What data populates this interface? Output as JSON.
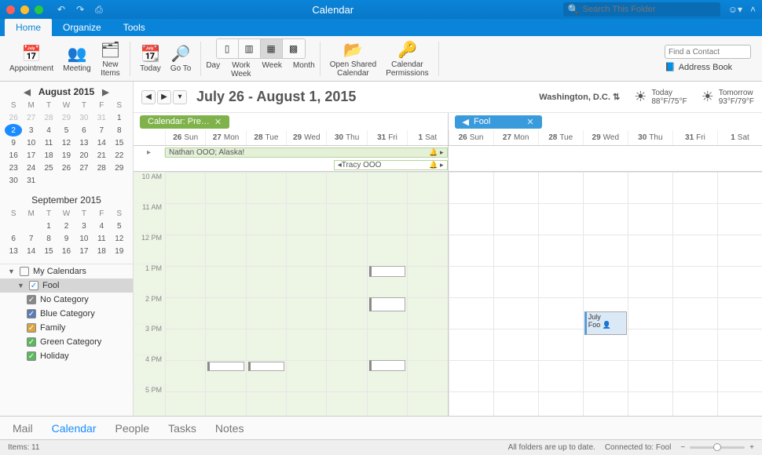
{
  "window": {
    "title": "Calendar",
    "search_placeholder": "Search This Folder"
  },
  "tabs": [
    "Home",
    "Organize",
    "Tools"
  ],
  "ribbon": {
    "appointment": "Appointment",
    "meeting": "Meeting",
    "new_items": "New\nItems",
    "today": "Today",
    "goto": "Go To",
    "view_day": "Day",
    "view_work": "Work\nWeek",
    "view_week": "Week",
    "view_month": "Month",
    "open_shared": "Open Shared\nCalendar",
    "permissions": "Calendar\nPermissions",
    "find_contact": "Find a Contact",
    "address_book": "Address Book"
  },
  "mini_cal": {
    "month1": "August 2015",
    "dows": [
      "S",
      "M",
      "T",
      "W",
      "T",
      "F",
      "S"
    ],
    "rows1": [
      [
        "26",
        "27",
        "28",
        "29",
        "30",
        "31",
        "1"
      ],
      [
        "2",
        "3",
        "4",
        "5",
        "6",
        "7",
        "8"
      ],
      [
        "9",
        "10",
        "11",
        "12",
        "13",
        "14",
        "15"
      ],
      [
        "16",
        "17",
        "18",
        "19",
        "20",
        "21",
        "22"
      ],
      [
        "23",
        "24",
        "25",
        "26",
        "27",
        "28",
        "29"
      ],
      [
        "30",
        "31",
        "",
        "",
        "",
        "",
        ""
      ]
    ],
    "month2": "September 2015",
    "rows2": [
      [
        "",
        "",
        "1",
        "2",
        "3",
        "4",
        "5"
      ],
      [
        "6",
        "7",
        "8",
        "9",
        "10",
        "11",
        "12"
      ],
      [
        "13",
        "14",
        "15",
        "16",
        "17",
        "18",
        "19"
      ]
    ]
  },
  "calendars": {
    "header": "My Calendars",
    "fool": "Fool",
    "items": [
      {
        "label": "No Category",
        "color": "#888"
      },
      {
        "label": "Blue Category",
        "color": "#5b7bb5"
      },
      {
        "label": "Family",
        "color": "#d9a441"
      },
      {
        "label": "Green Category",
        "color": "#5cb85c"
      },
      {
        "label": "Holiday",
        "color": "#5cb85c"
      }
    ]
  },
  "header": {
    "range": "July 26 - August 1, 2015"
  },
  "weather": {
    "location": "Washington,  D.C.",
    "today_label": "Today",
    "today_temp": "88°F/75°F",
    "tomorrow_label": "Tomorrow",
    "tomorrow_temp": "93°F/79°F"
  },
  "panes": {
    "left_title": "Calendar: Pre…",
    "right_title": "Fool",
    "days": [
      {
        "n": "26",
        "d": "Sun"
      },
      {
        "n": "27",
        "d": "Mon"
      },
      {
        "n": "28",
        "d": "Tue"
      },
      {
        "n": "29",
        "d": "Wed"
      },
      {
        "n": "30",
        "d": "Thu"
      },
      {
        "n": "31",
        "d": "Fri"
      },
      {
        "n": "1",
        "d": "Sat"
      }
    ],
    "allday1": "Nathan OOO; Alaska!",
    "allday2": "Tracy OOO",
    "hours": [
      "10 AM",
      "11 AM",
      "12 PM",
      "1 PM",
      "2 PM",
      "3 PM",
      "4 PM",
      "5 PM"
    ],
    "right_event": "July\nFoo"
  },
  "bottom_nav": [
    "Mail",
    "Calendar",
    "People",
    "Tasks",
    "Notes"
  ],
  "status": {
    "items": "Items: 11",
    "folders": "All folders are up to date.",
    "connected": "Connected to: Fool"
  }
}
